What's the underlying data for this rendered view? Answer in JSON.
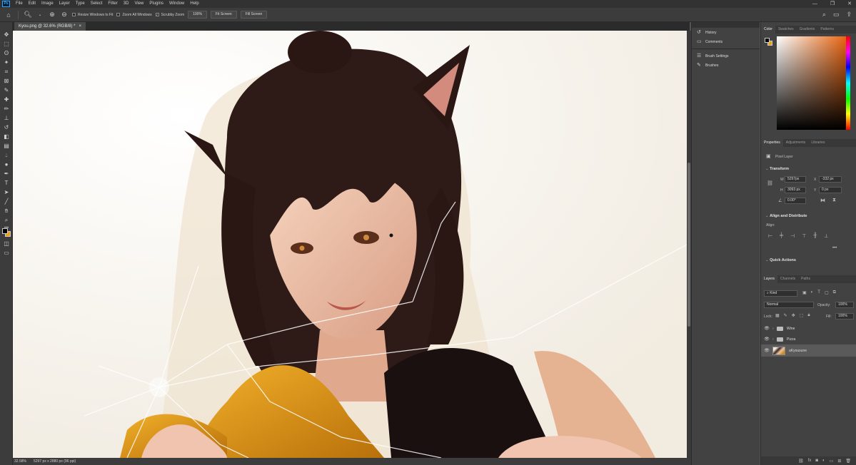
{
  "menubar": {
    "logo": "Ps",
    "items": [
      "File",
      "Edit",
      "Image",
      "Layer",
      "Type",
      "Select",
      "Filter",
      "3D",
      "View",
      "Plugins",
      "Window",
      "Help"
    ],
    "controls": [
      "—",
      "❐",
      "✕"
    ]
  },
  "options": {
    "resize_windows_label": "Resize Windows to Fit",
    "zoom_all_label": "Zoom All Windows",
    "scrubby_zoom_label": "Scrubby Zoom",
    "zoom_value": "100%",
    "fit_screen_label": "Fit Screen",
    "fill_screen_label": "Fill Screen"
  },
  "document": {
    "tab_title": "Kyou.png @ 32.6% (RGB/8) *",
    "tab_close": "×"
  },
  "status": {
    "zoom": "32.58%",
    "dimensions": "5297 px x 2880 px (96 ppi)"
  },
  "collapsed_panels": {
    "items": [
      {
        "label": "History",
        "icon": "history-icon"
      },
      {
        "label": "Comments",
        "icon": "comments-icon"
      },
      {
        "label": "Brush Settings",
        "icon": "brush-settings-icon"
      },
      {
        "label": "Brushes",
        "icon": "brushes-icon"
      }
    ]
  },
  "color_panel": {
    "tabs": [
      "Color",
      "Swatches",
      "Gradients",
      "Patterns"
    ],
    "foreground": "#000000",
    "background": "#e8a018"
  },
  "properties": {
    "tabs": [
      "Properties",
      "Adjustments",
      "Libraries"
    ],
    "layer_kind": "Pixel Layer",
    "transform_title": "Transform",
    "w_label": "W",
    "w_value": "5297px",
    "h_label": "H",
    "h_value": "3093 px",
    "x_label": "X",
    "x_value": "-332 px",
    "y_label": "Y",
    "y_value": "0 px",
    "angle_value": "0.00°",
    "align_title": "Align and Distribute",
    "align_label": "Align:",
    "more": "•••",
    "quick_actions_title": "Quick Actions"
  },
  "layers_panel": {
    "tabs": [
      "Layers",
      "Channels",
      "Paths"
    ],
    "filter_kind": "Kind",
    "blend_mode": "Normal",
    "opacity_label": "Opacity:",
    "opacity_value": "100%",
    "lock_label": "Lock:",
    "fill_label": "Fill:",
    "fill_value": "100%",
    "layers": [
      {
        "name": "Wine",
        "type": "group"
      },
      {
        "name": "Pizza",
        "type": "group"
      },
      {
        "name": "aKyousune",
        "type": "pixel"
      }
    ]
  },
  "colors": {
    "accent_orange": "#e8a018",
    "panel_bg": "#424242",
    "menubar_bg": "#323232"
  }
}
